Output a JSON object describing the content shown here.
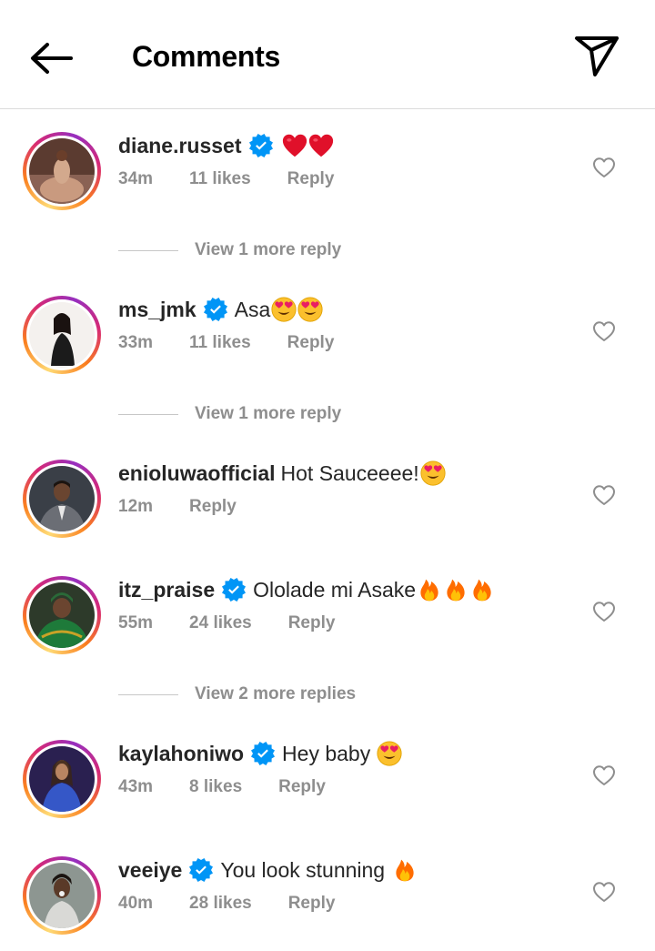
{
  "header": {
    "title": "Comments",
    "back_icon": "arrow-left-icon",
    "send_icon": "paper-plane-icon"
  },
  "comments": [
    {
      "username": "diane.russet",
      "verified": true,
      "text": "",
      "emojis": [
        "heart",
        "heart"
      ],
      "time": "34m",
      "likes": "11 likes",
      "reply": "Reply",
      "view_replies": "View 1 more reply"
    },
    {
      "username": "ms_jmk",
      "verified": true,
      "text": "Asa",
      "emojis": [
        "heart-eyes",
        "heart-eyes"
      ],
      "time": "33m",
      "likes": "11 likes",
      "reply": "Reply",
      "view_replies": "View 1 more reply"
    },
    {
      "username": "enioluwaofficial",
      "verified": false,
      "text": "Hot Sauceeee!",
      "emojis": [
        "heart-eyes"
      ],
      "time": "12m",
      "likes": "",
      "reply": "Reply",
      "view_replies": ""
    },
    {
      "username": "itz_praise",
      "verified": true,
      "text": "Ololade mi Asake",
      "emojis": [
        "fire",
        "fire",
        "fire"
      ],
      "time": "55m",
      "likes": "24 likes",
      "reply": "Reply",
      "view_replies": "View 2 more replies"
    },
    {
      "username": "kaylahoniwo",
      "verified": true,
      "text": "Hey baby",
      "emojis": [
        "heart-eyes"
      ],
      "time": "43m",
      "likes": "8 likes",
      "reply": "Reply",
      "view_replies": ""
    },
    {
      "username": "veeiye",
      "verified": true,
      "text": "You look stunning",
      "emojis": [
        "fire"
      ],
      "time": "40m",
      "likes": "28 likes",
      "reply": "Reply",
      "view_replies": ""
    }
  ],
  "colors": {
    "verified": "#0095f6",
    "muted": "#8e8e8e",
    "text": "#262626",
    "divider": "#dbdbdb"
  }
}
